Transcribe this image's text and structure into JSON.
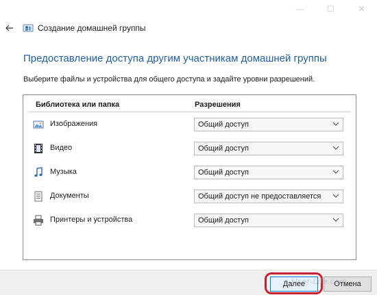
{
  "window": {
    "title": "Создание домашней группы",
    "back_icon": "arrow-left-icon",
    "app_icon": "homegroup-icon",
    "controls": {
      "minimize": "—",
      "maximize": "☐",
      "close": "✕"
    }
  },
  "main": {
    "heading": "Предоставление доступа другим участникам домашней группы",
    "description": "Выберите файлы и устройства для общего доступа и задайте уровни разрешений."
  },
  "table": {
    "headers": {
      "library": "Библиотека или папка",
      "permissions": "Разрешения"
    },
    "rows": [
      {
        "icon": "pictures-icon",
        "label": "Изображения",
        "permission": "Общий доступ"
      },
      {
        "icon": "video-icon",
        "label": "Видео",
        "permission": "Общий доступ"
      },
      {
        "icon": "music-icon",
        "label": "Музыка",
        "permission": "Общий доступ"
      },
      {
        "icon": "documents-icon",
        "label": "Документы",
        "permission": "Общий доступ не предоставляется"
      },
      {
        "icon": "printer-icon",
        "label": "Принтеры и устройства",
        "permission": "Общий доступ"
      }
    ]
  },
  "footer": {
    "next_label": "Далее",
    "cancel_label": "Отмена",
    "watermark": "User-Life.com"
  },
  "colors": {
    "accent": "#1e5ea8",
    "highlight": "#c8202d"
  }
}
